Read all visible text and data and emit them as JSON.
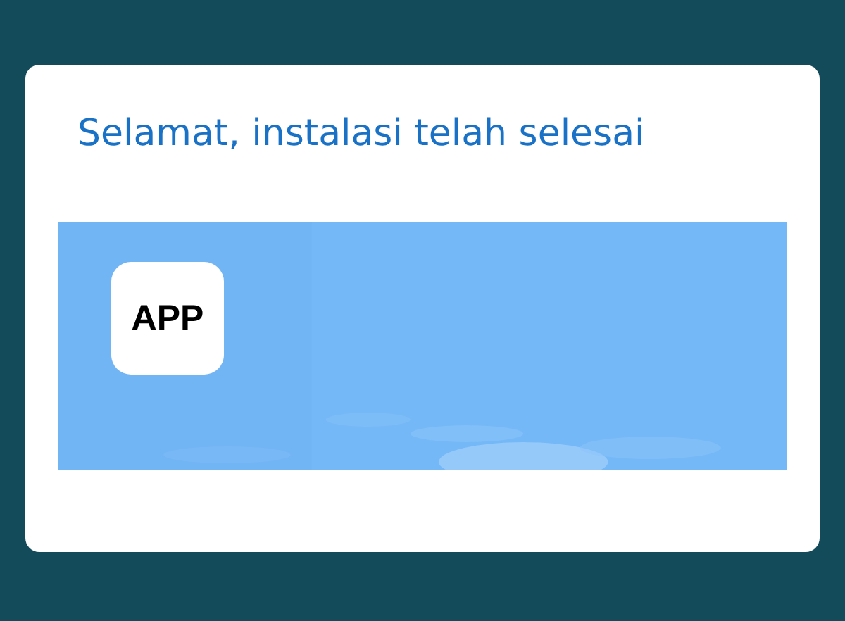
{
  "dialog": {
    "title": "Selamat, instalasi telah selesai",
    "banner": {
      "kind": "picture",
      "app_logo": "APP"
    }
  }
}
